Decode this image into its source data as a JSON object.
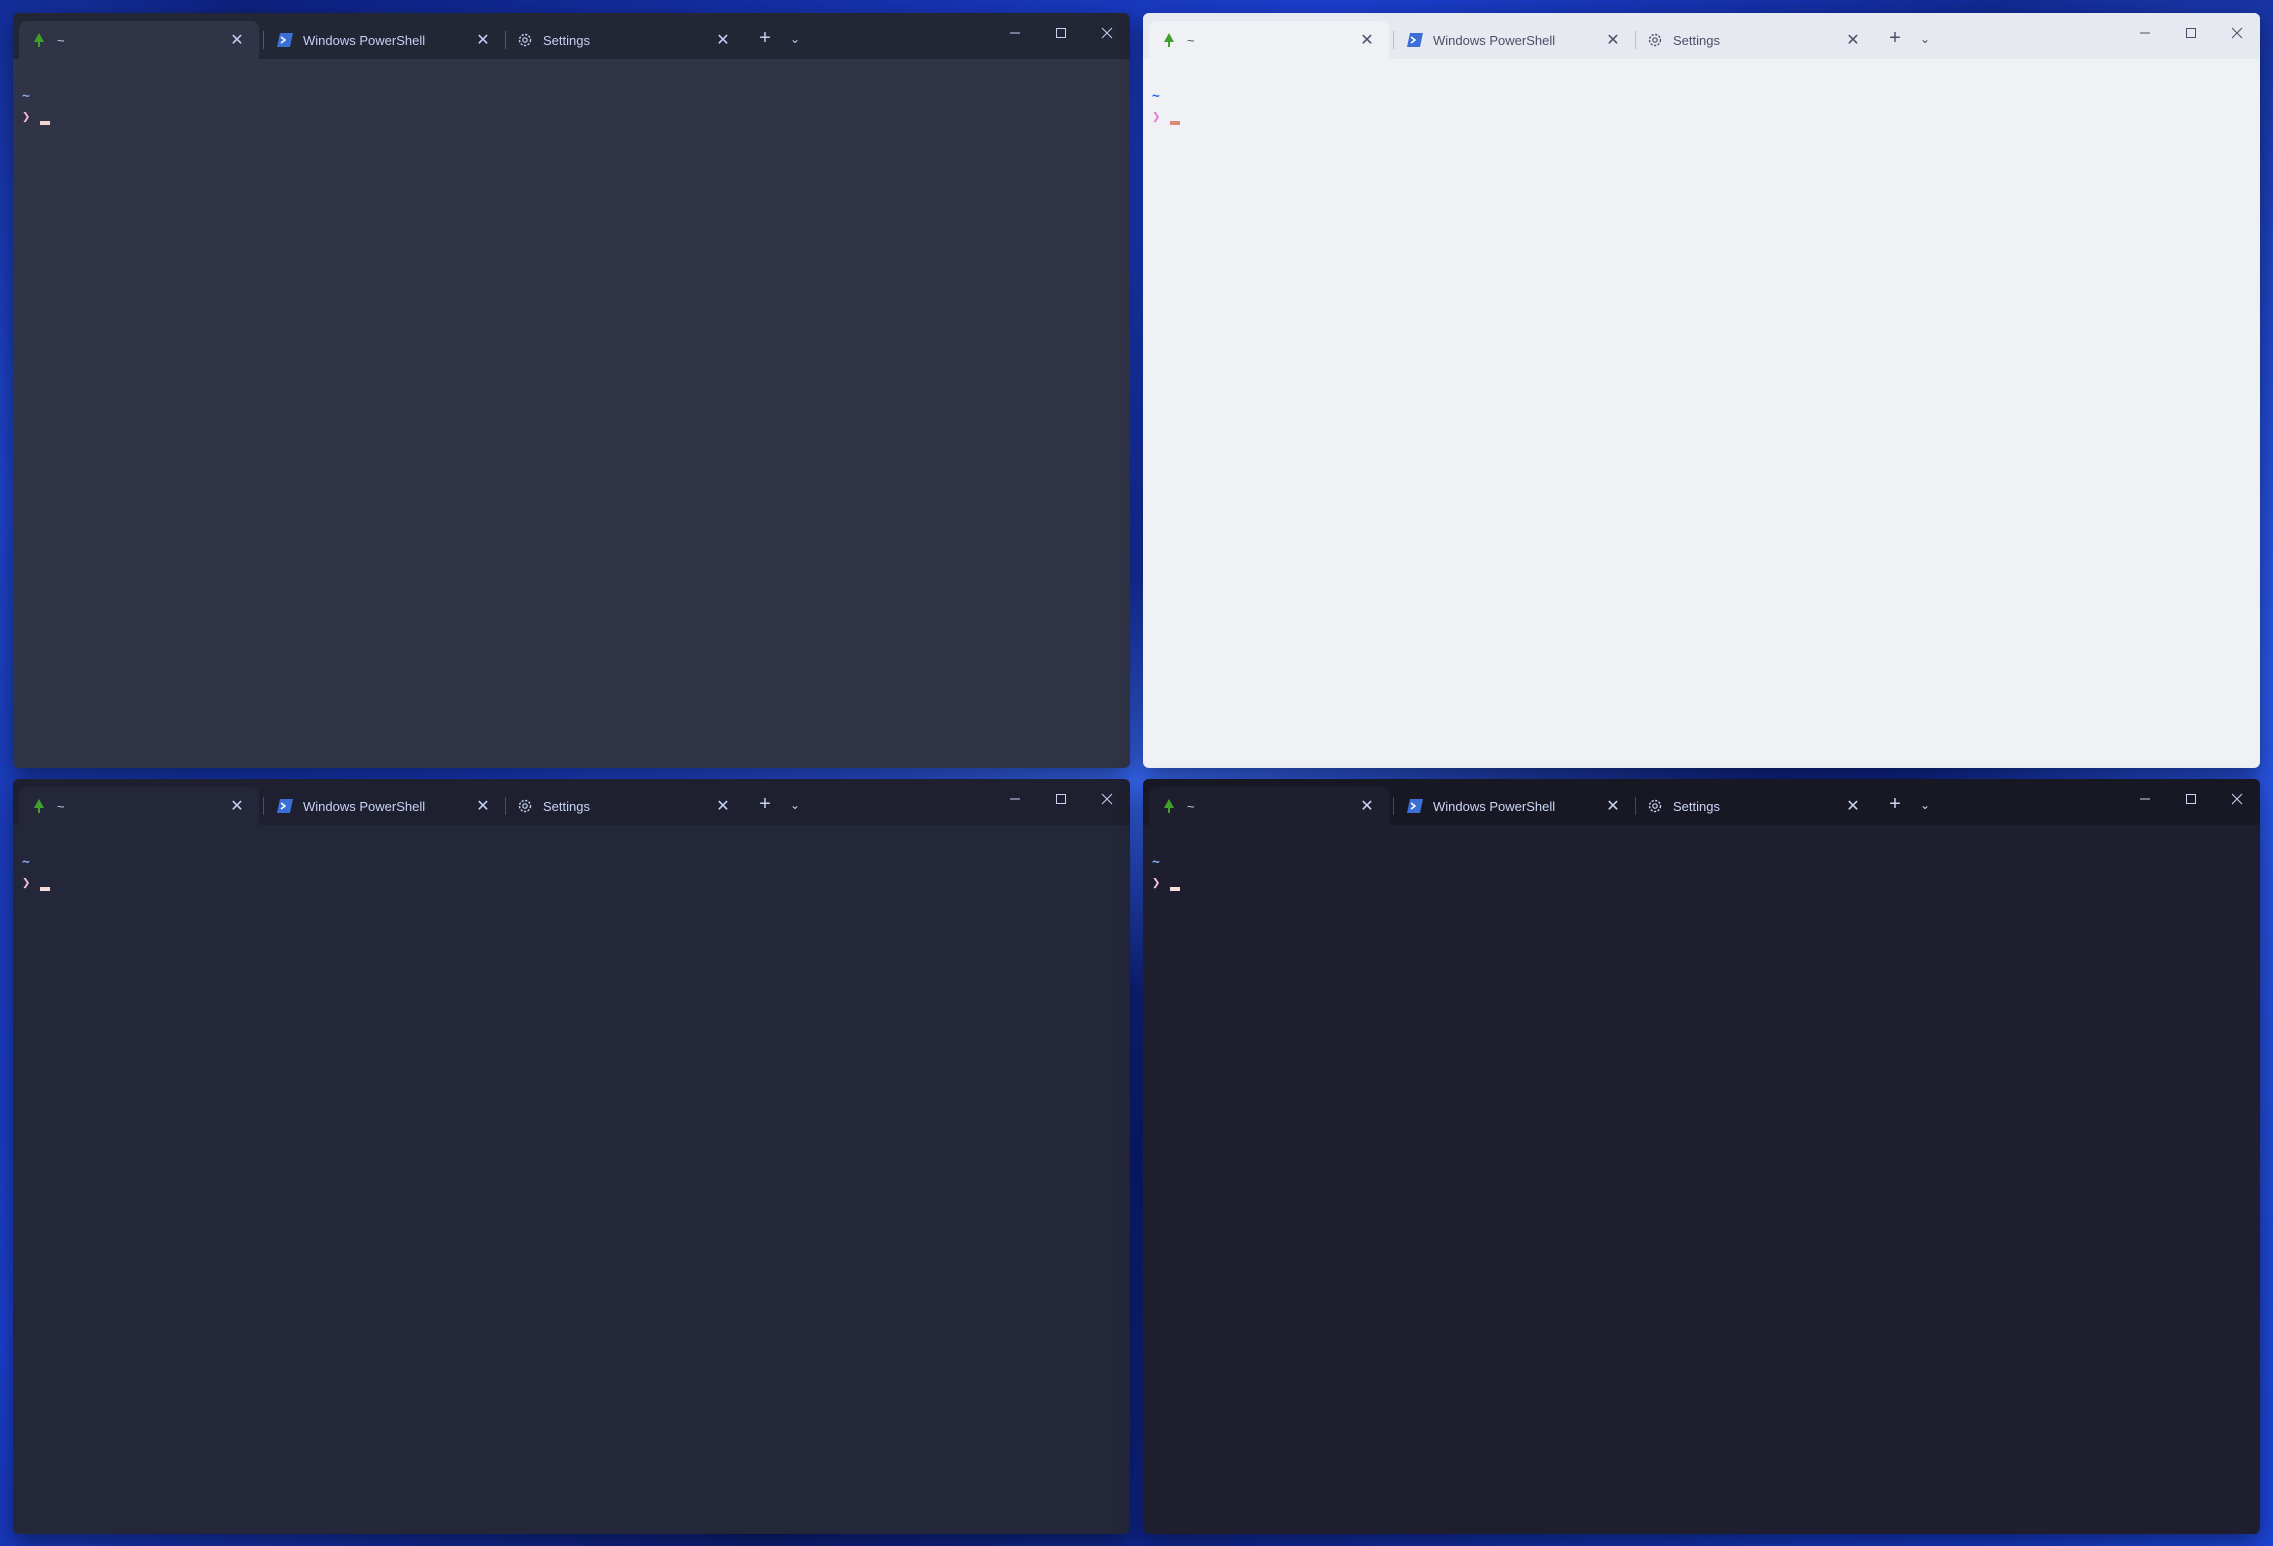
{
  "windows": [
    {
      "theme": "dark-slate",
      "tabs": [
        {
          "icon": "tree-icon",
          "title": "~",
          "active": true
        },
        {
          "icon": "powershell-icon",
          "title": "Windows PowerShell",
          "active": false
        },
        {
          "icon": "gear-icon",
          "title": "Settings",
          "active": false
        }
      ],
      "terminal": {
        "cwd": "~",
        "prompt": "❯"
      }
    },
    {
      "theme": "light",
      "tabs": [
        {
          "icon": "tree-icon",
          "title": "~",
          "active": true
        },
        {
          "icon": "powershell-icon",
          "title": "Windows PowerShell",
          "active": false
        },
        {
          "icon": "gear-icon",
          "title": "Settings",
          "active": false
        }
      ],
      "terminal": {
        "cwd": "~",
        "prompt": "❯"
      }
    },
    {
      "theme": "macchiato",
      "tabs": [
        {
          "icon": "tree-icon",
          "title": "~",
          "active": true
        },
        {
          "icon": "powershell-icon",
          "title": "Windows PowerShell",
          "active": false
        },
        {
          "icon": "gear-icon",
          "title": "Settings",
          "active": false
        }
      ],
      "terminal": {
        "cwd": "~",
        "prompt": "❯"
      }
    },
    {
      "theme": "mocha",
      "tabs": [
        {
          "icon": "tree-icon",
          "title": "~",
          "active": true
        },
        {
          "icon": "powershell-icon",
          "title": "Windows PowerShell",
          "active": false
        },
        {
          "icon": "gear-icon",
          "title": "Settings",
          "active": false
        }
      ],
      "terminal": {
        "cwd": "~",
        "prompt": "❯"
      }
    }
  ],
  "colors": {
    "tree_icon": "#40a02b",
    "powershell_icon": "#3b6fd6"
  }
}
